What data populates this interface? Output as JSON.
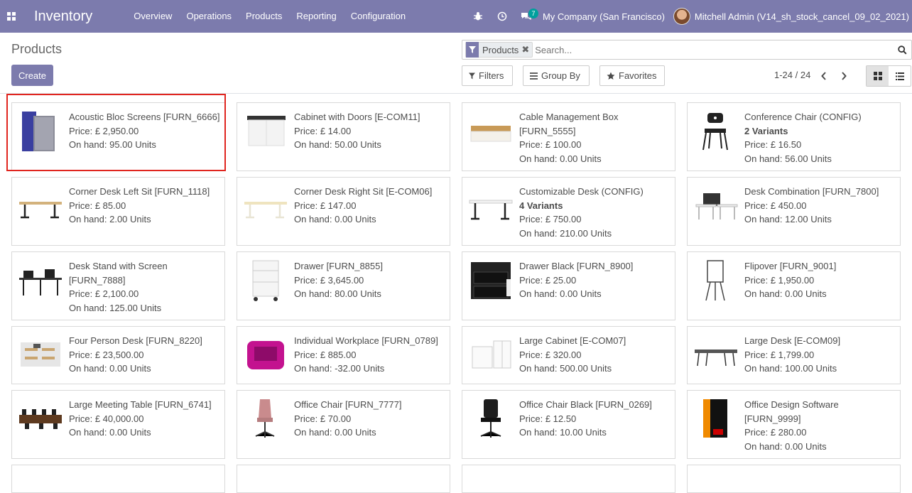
{
  "app": {
    "title": "Inventory",
    "menu": [
      "Overview",
      "Operations",
      "Products",
      "Reporting",
      "Configuration"
    ],
    "message_count": "7",
    "company": "My Company (San Francisco)",
    "user": "Mitchell Admin (V14_sh_stock_cancel_09_02_2021)"
  },
  "control_panel": {
    "page_title": "Products",
    "create_label": "Create",
    "search": {
      "facet_label": "Products",
      "facet_close": "✖",
      "placeholder": "Search..."
    },
    "filters_label": "Filters",
    "groupby_label": "Group By",
    "favorites_label": "Favorites",
    "pager": "1-24 / 24"
  },
  "products": [
    {
      "name": "Acoustic Bloc Screens [FURN_6666]",
      "price": "Price: £ 2,950.00",
      "onhand": "On hand: 95.00 Units",
      "variants": "",
      "icon": "acoustic-screen"
    },
    {
      "name": "Cabinet with Doors [E-COM11]",
      "price": "Price: £ 14.00",
      "onhand": "On hand: 50.00 Units",
      "variants": "",
      "icon": "cabinet"
    },
    {
      "name": "Cable Management Box [FURN_5555]",
      "price": "Price: £ 100.00",
      "onhand": "On hand: 0.00 Units",
      "variants": "",
      "icon": "cable-box"
    },
    {
      "name": "Conference Chair (CONFIG)",
      "price": "Price: £ 16.50",
      "onhand": "On hand: 56.00 Units",
      "variants": "2 Variants",
      "icon": "conference-chair"
    },
    {
      "name": "Corner Desk Left Sit [FURN_1118]",
      "price": "Price: £ 85.00",
      "onhand": "On hand: 2.00 Units",
      "variants": "",
      "icon": "desk-dark"
    },
    {
      "name": "Corner Desk Right Sit [E-COM06]",
      "price": "Price: £ 147.00",
      "onhand": "On hand: 0.00 Units",
      "variants": "",
      "icon": "desk-light"
    },
    {
      "name": "Customizable Desk (CONFIG)",
      "price": "Price: £ 750.00",
      "onhand": "On hand: 210.00 Units",
      "variants": "4 Variants",
      "icon": "desk-white"
    },
    {
      "name": "Desk Combination [FURN_7800]",
      "price": "Price: £ 450.00",
      "onhand": "On hand: 12.00 Units",
      "variants": "",
      "icon": "desk-combo"
    },
    {
      "name": "Desk Stand with Screen [FURN_7888]",
      "price": "Price: £ 2,100.00",
      "onhand": "On hand: 125.00 Units",
      "variants": "",
      "icon": "desk-stand"
    },
    {
      "name": "Drawer [FURN_8855]",
      "price": "Price: £ 3,645.00",
      "onhand": "On hand: 80.00 Units",
      "variants": "",
      "icon": "drawer-white"
    },
    {
      "name": "Drawer Black [FURN_8900]",
      "price": "Price: £ 25.00",
      "onhand": "On hand: 0.00 Units",
      "variants": "",
      "icon": "drawer-black"
    },
    {
      "name": "Flipover [FURN_9001]",
      "price": "Price: £ 1,950.00",
      "onhand": "On hand: 0.00 Units",
      "variants": "",
      "icon": "flipover"
    },
    {
      "name": "Four Person Desk [FURN_8220]",
      "price": "Price: £ 23,500.00",
      "onhand": "On hand: 0.00 Units",
      "variants": "",
      "icon": "four-desk"
    },
    {
      "name": "Individual Workplace [FURN_0789]",
      "price": "Price: £ 885.00",
      "onhand": "On hand: -32.00 Units",
      "variants": "",
      "icon": "workplace"
    },
    {
      "name": "Large Cabinet [E-COM07]",
      "price": "Price: £ 320.00",
      "onhand": "On hand: 500.00 Units",
      "variants": "",
      "icon": "large-cabinet"
    },
    {
      "name": "Large Desk [E-COM09]",
      "price": "Price: £ 1,799.00",
      "onhand": "On hand: 100.00 Units",
      "variants": "",
      "icon": "large-desk"
    },
    {
      "name": "Large Meeting Table [FURN_6741]",
      "price": "Price: £ 40,000.00",
      "onhand": "On hand: 0.00 Units",
      "variants": "",
      "icon": "meeting-table"
    },
    {
      "name": "Office Chair [FURN_7777]",
      "price": "Price: £ 70.00",
      "onhand": "On hand: 0.00 Units",
      "variants": "",
      "icon": "office-chair-pink"
    },
    {
      "name": "Office Chair Black [FURN_0269]",
      "price": "Price: £ 12.50",
      "onhand": "On hand: 10.00 Units",
      "variants": "",
      "icon": "office-chair-black"
    },
    {
      "name": "Office Design Software [FURN_9999]",
      "price": "Price: £ 280.00",
      "onhand": "On hand: 0.00 Units",
      "variants": "",
      "icon": "software-box"
    }
  ]
}
